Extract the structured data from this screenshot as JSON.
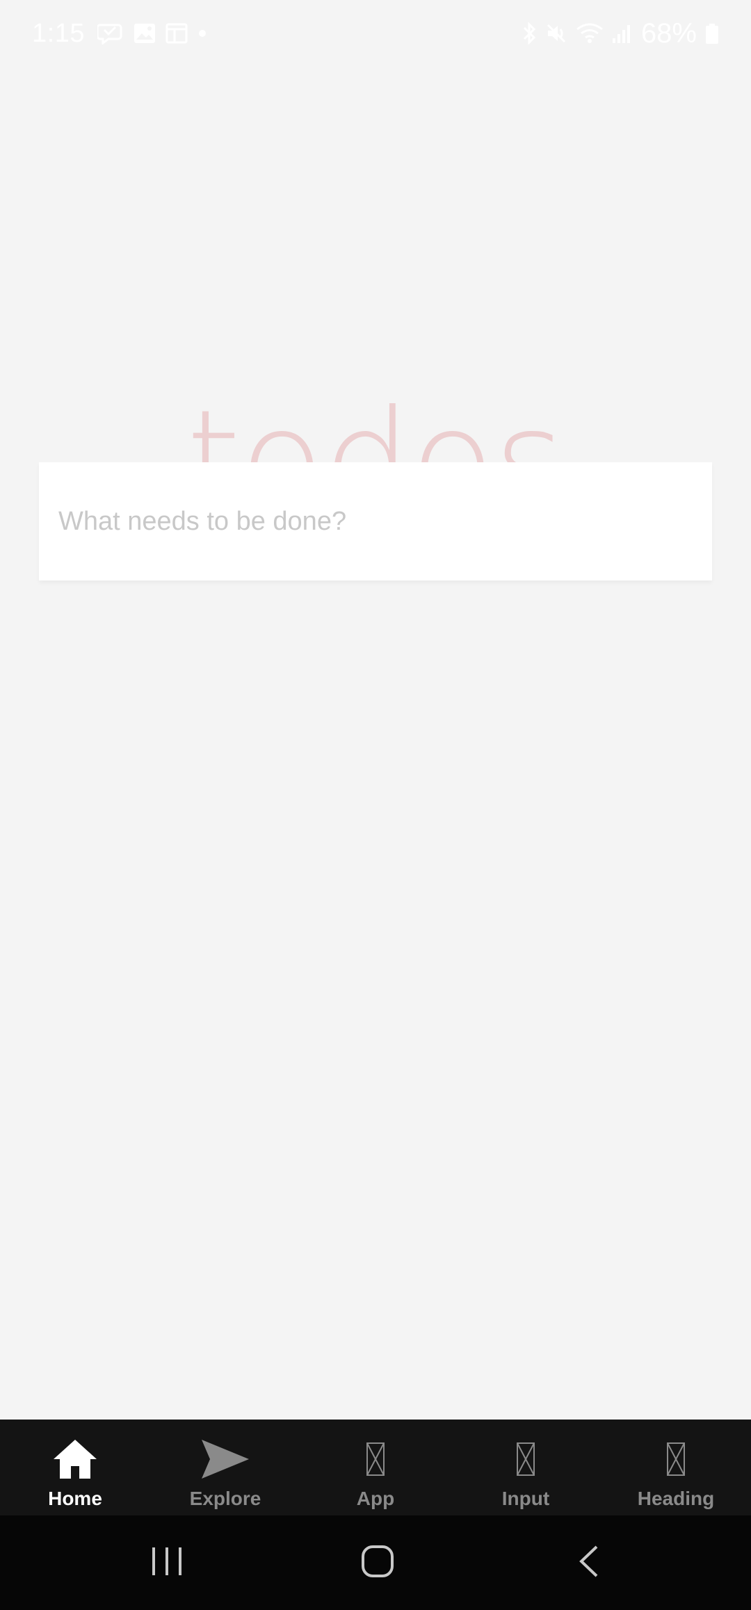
{
  "status_bar": {
    "time": "1:15",
    "battery": "68%",
    "left_icons": [
      "chat-bubble-icon",
      "photo-icon",
      "calendar-icon",
      "dot-icon"
    ],
    "right_icons": [
      "bluetooth-icon",
      "mute-icon",
      "wifi-icon",
      "signal-icon",
      "battery-icon"
    ]
  },
  "app": {
    "title": "todos",
    "new_todo": {
      "placeholder": "What needs to be done?",
      "value": ""
    }
  },
  "tabs": [
    {
      "label": "Home",
      "icon": "home-icon",
      "active": true
    },
    {
      "label": "Explore",
      "icon": "send-icon",
      "active": false
    },
    {
      "label": "App",
      "icon": "missing-glyph-icon",
      "active": false
    },
    {
      "label": "Input",
      "icon": "missing-glyph-icon",
      "active": false
    },
    {
      "label": "Heading",
      "icon": "missing-glyph-icon",
      "active": false
    }
  ],
  "nav": {
    "buttons": [
      "recent-apps-icon",
      "home-button-icon",
      "back-icon"
    ]
  },
  "colors": {
    "background": "#f4f4f4",
    "title": "#eccfd0",
    "tab_bar": "#141414",
    "tab_active": "#ffffff",
    "tab_inactive": "#8a8a8a",
    "nav_bar": "#060606"
  }
}
